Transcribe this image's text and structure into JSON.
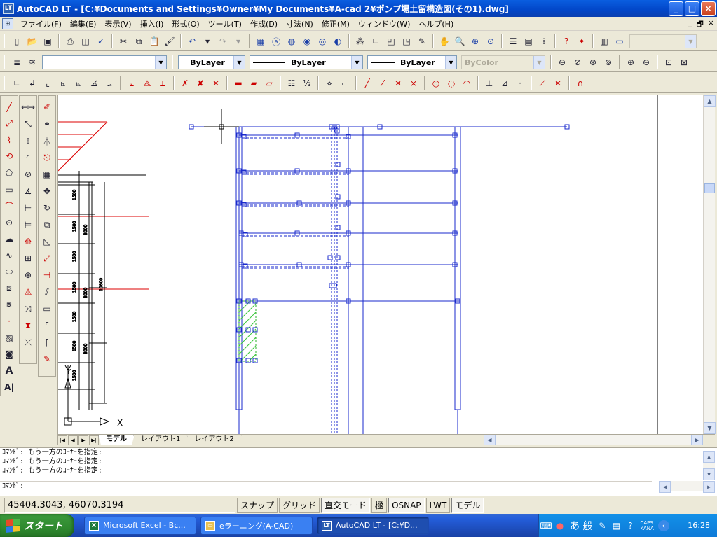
{
  "window": {
    "title": "AutoCAD LT - [C:¥Documents and Settings¥Owner¥My Documents¥A-cad 2¥ポンプ場土留構造図(その1).dwg]",
    "app_icon": "LT",
    "minimize": "_",
    "maximize": "□",
    "close": "×"
  },
  "menu": {
    "items": [
      "ファイル(F)",
      "編集(E)",
      "表示(V)",
      "挿入(I)",
      "形式(O)",
      "ツール(T)",
      "作成(D)",
      "寸法(N)",
      "修正(M)",
      "ウィンドウ(W)",
      "ヘルプ(H)"
    ],
    "mdi": [
      "_",
      "🗗",
      "×"
    ]
  },
  "props": {
    "layer_combo": "",
    "color": "ByLayer",
    "linetype": "ByLayer",
    "lineweight": "ByLayer",
    "plotstyle": "ByColor"
  },
  "tabs": {
    "items": [
      "モデル",
      "レイアウト1",
      "レイアウト2"
    ],
    "active": 0
  },
  "command": {
    "history": [
      "ｺﾏﾝﾄﾞ: もう一方のｺｰﾅｰを指定:",
      "ｺﾏﾝﾄﾞ: もう一方のｺｰﾅｰを指定:",
      "ｺﾏﾝﾄﾞ: もう一方のｺｰﾅｰを指定:"
    ],
    "prompt": "ｺﾏﾝﾄﾞ:"
  },
  "status": {
    "coords": "45404.3043, 46070.3194",
    "buttons": [
      "スナップ",
      "グリッド",
      "直交モード",
      "極",
      "OSNAP",
      "LWT",
      "モデル"
    ]
  },
  "drawing": {
    "ucs_x": "X",
    "ucs_y": "Y"
  },
  "taskbar": {
    "start": "スタート",
    "tasks": [
      "Microsoft Excel - Bc...",
      "eラーニング(A-CAD)",
      "AutoCAD LT - [C:¥D..."
    ],
    "tray_ime": "あ 般",
    "caps": "CAPS",
    "kana": "KANA",
    "clock": "16:28"
  }
}
